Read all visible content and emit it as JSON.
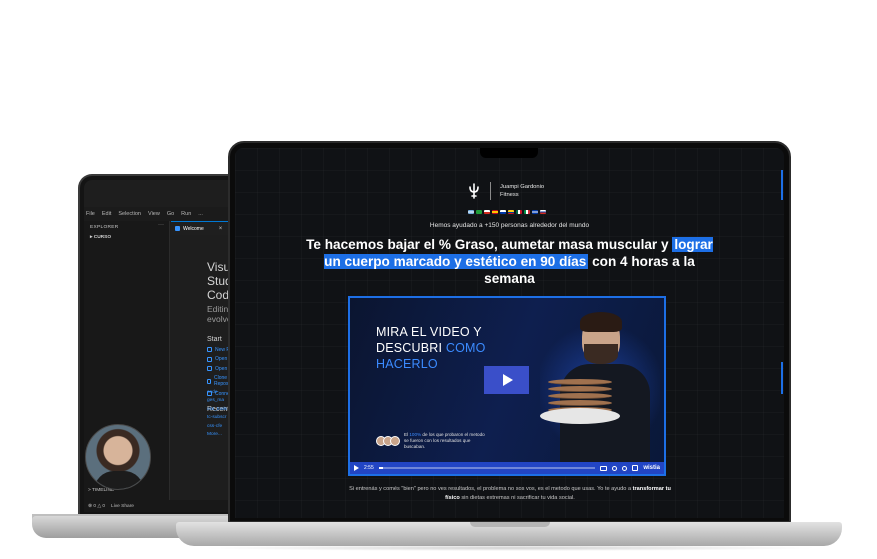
{
  "vscode": {
    "menu": [
      "File",
      "Edit",
      "Selection",
      "View",
      "Go",
      "Run",
      "..."
    ],
    "explorer_label": "EXPLORER",
    "folder_label": "CURSO",
    "tab_label": "Welcome",
    "welcome_title": "Visual Studio Code",
    "welcome_sub": "Editing evolved",
    "start_label": "Start",
    "start_items": [
      "New File...",
      "Open File...",
      "Open Folder...",
      "Clone Git Repository...",
      "Connect to..."
    ],
    "recent_label": "Recent",
    "recent_items": [
      "code",
      "ges_ma",
      "css_tools",
      "tc-subscr",
      "css-cfe",
      "More..."
    ],
    "timeline_label": "> TIMELINE",
    "status_items": [
      "⊗ 0 △ 0",
      "Live Share"
    ]
  },
  "landing": {
    "brand_name_line1": "Juampi Gardonio",
    "brand_name_line2": "Fitness",
    "helped_text": "Hemos ayudado a +150 personas alrededor del mundo",
    "headline_part1": "Te hacemos bajar el % Graso, aumetar masa muscular y",
    "headline_highlight": "lograr un cuerpo marcado y estético en 90 días",
    "headline_part2": "con 4 horas a la semana",
    "video": {
      "title_line1": "MIRA EL VIDEO Y",
      "title_line2": "DESCUBRI",
      "title_blue1": "COMO",
      "title_blue2": "HACERLO",
      "proof_prefix": "El",
      "proof_percent": "100%",
      "proof_text": "de los que probaron el metodo se fueron con los resultados que buscaban.",
      "time": "2:55",
      "progress": 0.02,
      "brand": "wistia"
    },
    "footer_pre": "Si entrenás y comés \"bien\" pero no ves resultados, el problema no sos vos, es el metodo que usas. Yo te ayudo a",
    "footer_bold": "transformar tu físico",
    "footer_post": "sin dietas extremas ni sacrificar tu vida social.",
    "accent_color": "#1d6fe6"
  }
}
